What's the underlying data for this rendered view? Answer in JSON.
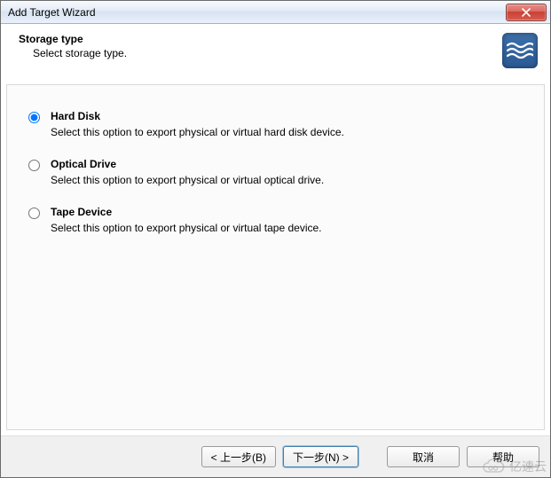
{
  "window": {
    "title": "Add Target Wizard"
  },
  "header": {
    "title": "Storage type",
    "subtitle": "Select storage type."
  },
  "options": [
    {
      "id": "hard-disk",
      "title": "Hard Disk",
      "desc": "Select this option to export physical or virtual hard disk device.",
      "selected": true
    },
    {
      "id": "optical-drive",
      "title": "Optical Drive",
      "desc": "Select this option to export physical or virtual optical drive.",
      "selected": false
    },
    {
      "id": "tape-device",
      "title": "Tape Device",
      "desc": "Select this option to export physical or virtual tape device.",
      "selected": false
    }
  ],
  "buttons": {
    "back": "< 上一步(B)",
    "next": "下一步(N) >",
    "cancel": "取消",
    "help": "帮助"
  },
  "watermark": {
    "text": "亿速云"
  }
}
